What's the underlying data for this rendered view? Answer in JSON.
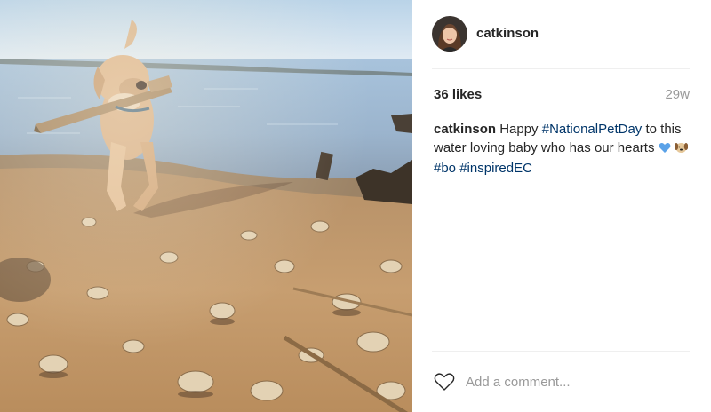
{
  "post": {
    "username": "catkinson",
    "likes": "36 likes",
    "time": "29w",
    "caption": {
      "user": "catkinson",
      "text1": " Happy ",
      "tag1": "#NationalPetDay",
      "text2": " to this water loving baby who has our hearts ",
      "tag2": "#bo",
      "tag3": "#inspiredEC"
    },
    "comment_placeholder": "Add a comment..."
  },
  "icons": {
    "like": "heart-outline-icon",
    "emoji1": "blue-heart-emoji",
    "emoji2": "dog-face-emoji"
  },
  "colors": {
    "hashtag": "#003569",
    "muted": "#999999",
    "divider": "#efefef"
  }
}
